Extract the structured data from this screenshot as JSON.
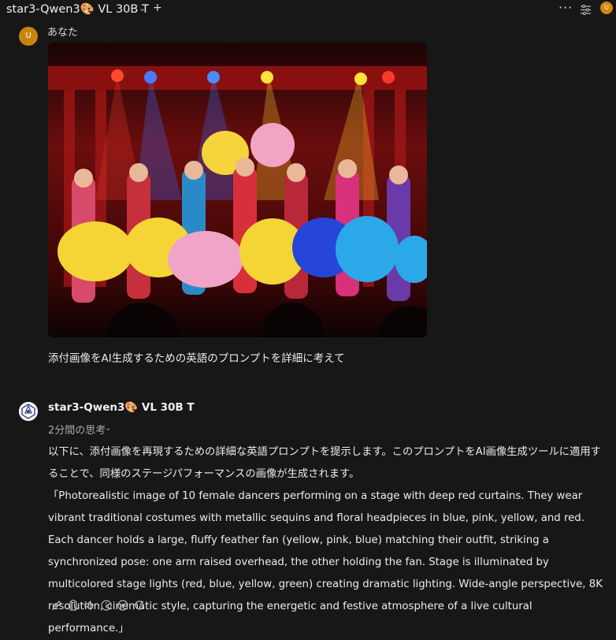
{
  "header": {
    "model_title": "star3-Qwen3🎨 VL 30B T",
    "more_label": "···",
    "avatar_initial": "U"
  },
  "user_message": {
    "avatar_initial": "U",
    "author": "あなた",
    "image_alt": "Stage performance with dancers holding feather fans",
    "text": "添付画像をAI生成するための英語のプロンプトを詳細に考えて"
  },
  "assistant_message": {
    "author": "star3-Qwen3🎨 VL 30B T",
    "thinking_label": "2分間の思考",
    "intro": "以下に、添付画像を再現するための詳細な英語プロンプトを提示します。このプロンプトをAI画像生成ツールに適用することで、同様のステージパフォーマンスの画像が生成されます。",
    "prompt": "「Photorealistic image of 10 female dancers performing on a stage with deep red curtains. They wear vibrant traditional costumes with metallic sequins and floral headpieces in blue, pink, yellow, and red. Each dancer holds a large, fluffy feather fan (yellow, pink, blue) matching their outfit, striking a synchronized pose: one arm raised overhead, the other holding the fan. Stage is illuminated by multicolored stage lights (red, blue, yellow, green) creating dramatic lighting. Wide-angle perspective, 8K resolution, cinematic style, capturing the energetic and festive atmosphere of a live cultural performance.」"
  },
  "actions": [
    "edit-icon",
    "copy-icon",
    "speaker-icon",
    "info-icon",
    "play-icon",
    "regenerate-icon"
  ],
  "colors": {
    "background": "#171717",
    "user_avatar": "#c9840f",
    "text": "#ececec",
    "muted": "#aaaaaa"
  }
}
